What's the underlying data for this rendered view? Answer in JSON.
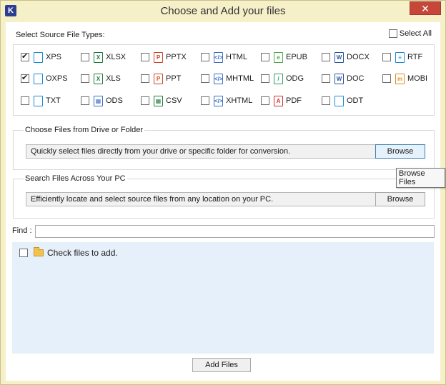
{
  "window": {
    "title": "Choose and Add your files",
    "app_icon_letter": "K",
    "close_symbol": "✕"
  },
  "types_section": {
    "label": "Select Source File Types:",
    "select_all": {
      "label": "Select All",
      "checked": false
    },
    "items": [
      {
        "label": "XPS",
        "checked": true,
        "icon_text": "",
        "color": "#1a8ad6"
      },
      {
        "label": "XLSX",
        "checked": false,
        "icon_text": "X",
        "color": "#1d7a3b"
      },
      {
        "label": "PPTX",
        "checked": false,
        "icon_text": "P",
        "color": "#d04423"
      },
      {
        "label": "HTML",
        "checked": false,
        "icon_text": "</>",
        "color": "#3a6fc4"
      },
      {
        "label": "EPUB",
        "checked": false,
        "icon_text": "e",
        "color": "#4aa84a"
      },
      {
        "label": "DOCX",
        "checked": false,
        "icon_text": "W",
        "color": "#2b579a"
      },
      {
        "label": "RTF",
        "checked": false,
        "icon_text": "≡",
        "color": "#1a8ad6"
      },
      {
        "label": "OXPS",
        "checked": true,
        "icon_text": "",
        "color": "#1a8ad6"
      },
      {
        "label": "XLS",
        "checked": false,
        "icon_text": "X",
        "color": "#1d7a3b"
      },
      {
        "label": "PPT",
        "checked": false,
        "icon_text": "P",
        "color": "#d04423"
      },
      {
        "label": "MHTML",
        "checked": false,
        "icon_text": "</>",
        "color": "#3a6fc4"
      },
      {
        "label": "ODG",
        "checked": false,
        "icon_text": "/",
        "color": "#2e9b6b"
      },
      {
        "label": "DOC",
        "checked": false,
        "icon_text": "W",
        "color": "#2b579a"
      },
      {
        "label": "MOBI",
        "checked": false,
        "icon_text": "m",
        "color": "#e38a1a"
      },
      {
        "label": "TXT",
        "checked": false,
        "icon_text": "",
        "color": "#1a8ad6"
      },
      {
        "label": "ODS",
        "checked": false,
        "icon_text": "▦",
        "color": "#3a6fc4"
      },
      {
        "label": "CSV",
        "checked": false,
        "icon_text": "▦",
        "color": "#1d7a3b"
      },
      {
        "label": "XHTML",
        "checked": false,
        "icon_text": "</>",
        "color": "#3a6fc4"
      },
      {
        "label": "PDF",
        "checked": false,
        "icon_text": "A",
        "color": "#d0302a"
      },
      {
        "label": "ODT",
        "checked": false,
        "icon_text": "",
        "color": "#1a8ad6"
      }
    ]
  },
  "drive_group": {
    "title": "Choose Files from Drive or Folder",
    "info": "Quickly select files directly from your drive or specific folder for conversion.",
    "button": "Browse",
    "tooltip": "Browse Files"
  },
  "search_group": {
    "title": "Search Files Across Your PC",
    "info": "Efficiently locate and select source files from any location on your PC.",
    "button": "Browse"
  },
  "find": {
    "label": "Find :",
    "value": ""
  },
  "files_area": {
    "label": "Check files to add."
  },
  "footer": {
    "add_button": "Add Files"
  }
}
